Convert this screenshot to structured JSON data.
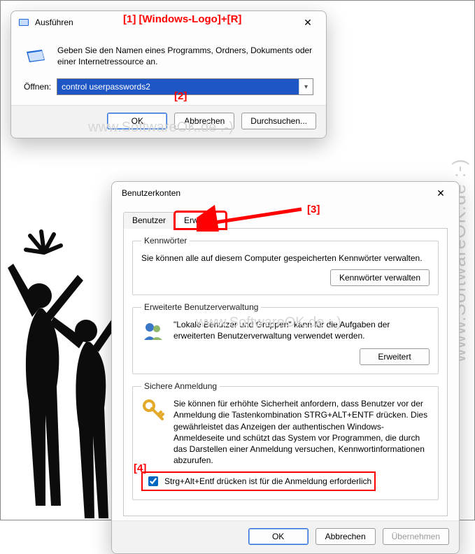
{
  "annotations": {
    "a1": "[1]  [Windows-Logo]+[R]",
    "a2": "[2]",
    "a3": "[3]",
    "a4": "[4]"
  },
  "watermark": "www.SoftwareOK.de :-)",
  "run": {
    "title": "Ausführen",
    "desc": "Geben Sie den Namen eines Programms, Ordners, Dokuments oder einer Internetressource an.",
    "open_label": "Öffnen:",
    "value": "control userpasswords2",
    "ok": "OK",
    "cancel": "Abbrechen",
    "browse": "Durchsuchen..."
  },
  "acct": {
    "title": "Benutzerkonten",
    "tab_user": "Benutzer",
    "tab_adv": "Erweitert",
    "pw_legend": "Kennwörter",
    "pw_text": "Sie können alle auf diesem Computer gespeicherten Kennwörter verwalten.",
    "pw_btn": "Kennwörter verwalten",
    "adv_legend": "Erweiterte Benutzerverwaltung",
    "adv_text": "\"Lokale Benutzer und Gruppen\" kann für die Aufgaben der erweiterten Benutzerverwaltung verwendet werden.",
    "adv_btn": "Erweitert",
    "sec_legend": "Sichere Anmeldung",
    "sec_text": "Sie können für erhöhte Sicherheit anfordern, dass Benutzer vor der Anmeldung die Tastenkombination STRG+ALT+ENTF drücken. Dies gewährleistet das Anzeigen der authentischen Windows-Anmeldeseite und schützt das System vor Programmen, die durch das Darstellen einer Anmeldung versuchen, Kennwortinformationen abzurufen.",
    "sec_check": "Strg+Alt+Entf drücken ist für die Anmeldung erforderlich",
    "ok": "OK",
    "cancel": "Abbrechen",
    "apply": "Übernehmen"
  }
}
